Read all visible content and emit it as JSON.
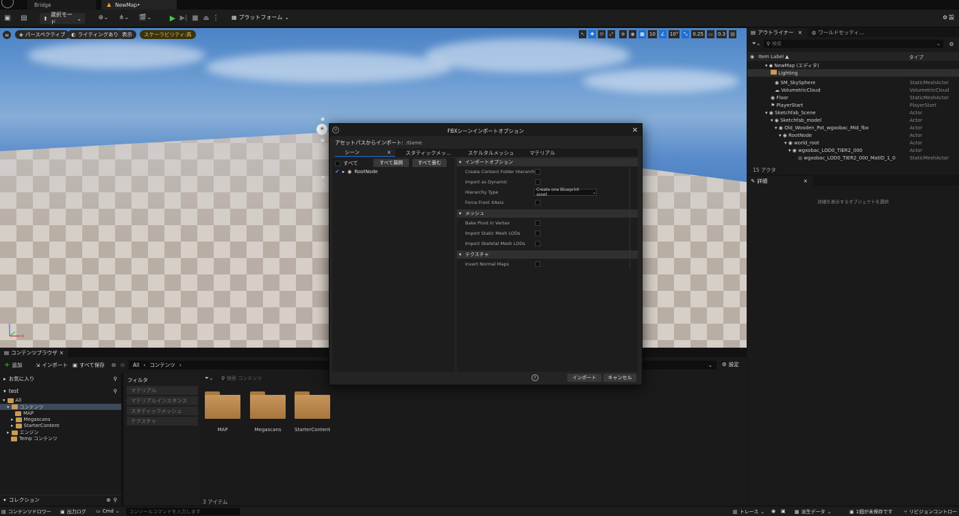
{
  "titlebar": {
    "tabs": [
      {
        "label": "Bridge"
      },
      {
        "label": "NewMap•"
      }
    ]
  },
  "toolbar": {
    "mode_label": "選択モード",
    "platform_label": "プラットフォーム",
    "settings_label": "設"
  },
  "viewport": {
    "perspective_label": "パースペクティブ",
    "lighting_label": "ライティングあり",
    "show_label": "表示",
    "scalability_label": "スケーラビリティ:高",
    "grid_value": "10",
    "angle_value": "10°",
    "scale_value": "0.25",
    "camera_value": "0.3"
  },
  "outliner": {
    "tab_outliner": "アウトライナー",
    "tab_world": "ワールドセッティ...",
    "search_placeholder": "検索",
    "col_label": "Item Label ▲",
    "col_type": "タイプ",
    "rows": [
      {
        "name": "NewMap (エディタ)",
        "type": ""
      },
      {
        "name": "Lighting",
        "type": ""
      },
      {
        "name": "SM_SkySphere",
        "type": "StaticMeshActor"
      },
      {
        "name": "VolumetricCloud",
        "type": "VolumetricCloud"
      },
      {
        "name": "Floor",
        "type": "StaticMeshActor"
      },
      {
        "name": "PlayerStart",
        "type": "PlayerStart"
      },
      {
        "name": "Sketchfab_Scene",
        "type": "Actor"
      },
      {
        "name": "Sketchfab_model",
        "type": "Actor"
      },
      {
        "name": "Old_Wooden_Pot_wgxobac_Mid_fbx",
        "type": "Actor"
      },
      {
        "name": "RootNode",
        "type": "Actor"
      },
      {
        "name": "world_root",
        "type": "Actor"
      },
      {
        "name": "wgxobac_LOD0_TIER2_000",
        "type": "Actor"
      },
      {
        "name": "wgxobac_LOD0_TIER2_000_MatID_1_0",
        "type": "StaticMeshActor"
      }
    ],
    "actor_count": "15 アクタ"
  },
  "details": {
    "tab_label": "詳細",
    "empty_text": "詳細を表示するオブジェクトを選択"
  },
  "content_browser": {
    "tab_label": "コンテンツブラウザ",
    "add_label": "追加",
    "import_label": "インポート",
    "save_all_label": "すべて保存",
    "path": [
      "All",
      "コンテンツ"
    ],
    "settings_label": "設定",
    "favorites_label": "お気に入り",
    "project_label": "test",
    "tree": [
      {
        "name": "All"
      },
      {
        "name": "コンテンツ"
      },
      {
        "name": "MAP"
      },
      {
        "name": "Megascans"
      },
      {
        "name": "StarterContent"
      },
      {
        "name": "エンジン"
      },
      {
        "name": "Temp コンテンツ"
      }
    ],
    "collections_label": "コレクション",
    "filters_label": "フィルタ",
    "filters": [
      "マテリアル",
      "マテリアルインスタンス",
      "スタティックメッシュ",
      "テクスチャ"
    ],
    "search_placeholder": "検索 コンテンツ",
    "items": [
      {
        "name": "MAP"
      },
      {
        "name": "Megascans"
      },
      {
        "name": "StarterContent"
      }
    ],
    "item_count": "3 アイテム"
  },
  "statusbar": {
    "drawer_label": "コンテンツドロワー",
    "output_log_label": "出力ログ",
    "cmd_label": "Cmd",
    "console_placeholder": "コンソールコマンドを入力します",
    "trace_label": "トレース",
    "derived_data_label": "派生データ",
    "unsaved_label": "1個が未保存です",
    "revision_label": "リビジョンコントロー"
  },
  "dialog": {
    "title": "FBXシーンインポートオプション",
    "asset_path_label": "アセットパスからインポート:",
    "asset_path_value": "/Game",
    "tabs": [
      {
        "label": "シーン"
      },
      {
        "label": "スタティックメッ..."
      },
      {
        "label": "スケルタルメッシュ"
      },
      {
        "label": "マテリアル"
      }
    ],
    "all_label": "すべて",
    "expand_all_label": "すべて展開",
    "collapse_all_label": "すべて畳む",
    "tree_node": "RootNode",
    "sections": {
      "import_options": "インポートオプション",
      "mesh": "メッシュ",
      "texture": "テクスチャ"
    },
    "options": {
      "create_folder": "Create Content Folder Hierarchy",
      "import_as_dynamic": "Import as Dynamic",
      "hierarchy_type": "Hierarchy Type",
      "hierarchy_value": "Create one Blueprint asset",
      "force_front": "Force Front XAxis",
      "bake_pivot": "Bake Pivot in Vertex",
      "import_static_lods": "Import Static Mesh LODs",
      "import_skeletal_lods": "Import Skeletal Mesh LODs",
      "invert_normal": "Invert Normal Maps"
    },
    "import_button": "インポート",
    "cancel_button": "キャンセル"
  }
}
